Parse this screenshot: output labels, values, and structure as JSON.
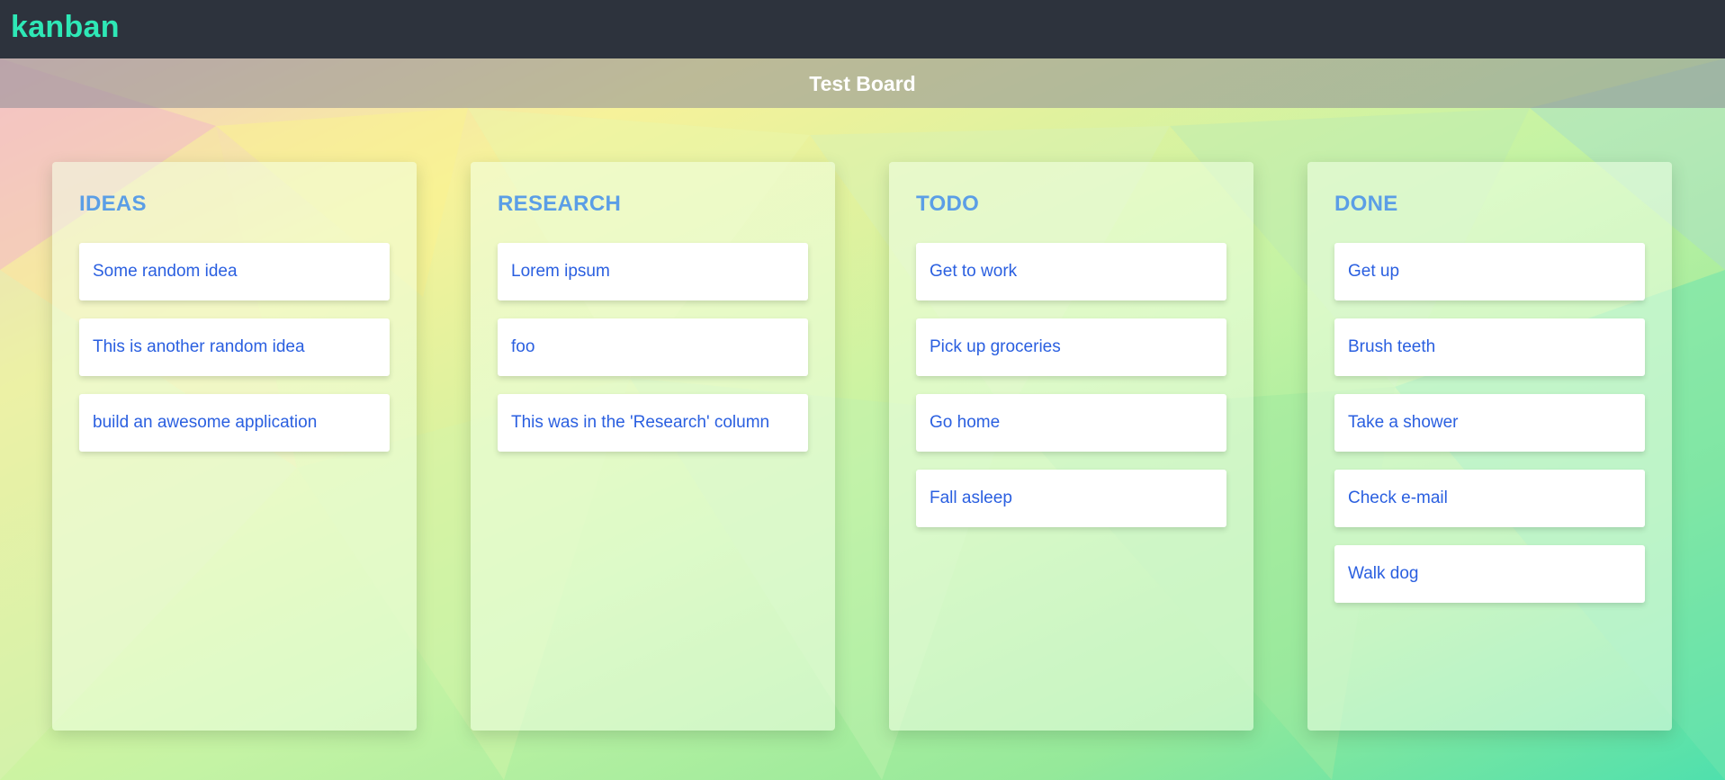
{
  "app": {
    "brand": "kanban",
    "brand_color": "#2ee8b6"
  },
  "board": {
    "title": "Test Board"
  },
  "theme": {
    "column_title_color": "#5b9ee6",
    "card_text_color": "#2a5fe0"
  },
  "columns": [
    {
      "title": "IDEAS",
      "cards": [
        "Some random idea",
        "This is another random idea",
        "build an awesome application"
      ]
    },
    {
      "title": "RESEARCH",
      "cards": [
        "Lorem ipsum",
        "foo",
        "This was in the 'Research' column"
      ]
    },
    {
      "title": "TODO",
      "cards": [
        "Get to work",
        "Pick up groceries",
        "Go home",
        "Fall asleep"
      ]
    },
    {
      "title": "DONE",
      "cards": [
        "Get up",
        "Brush teeth",
        "Take a shower",
        "Check e-mail",
        "Walk dog"
      ]
    }
  ]
}
